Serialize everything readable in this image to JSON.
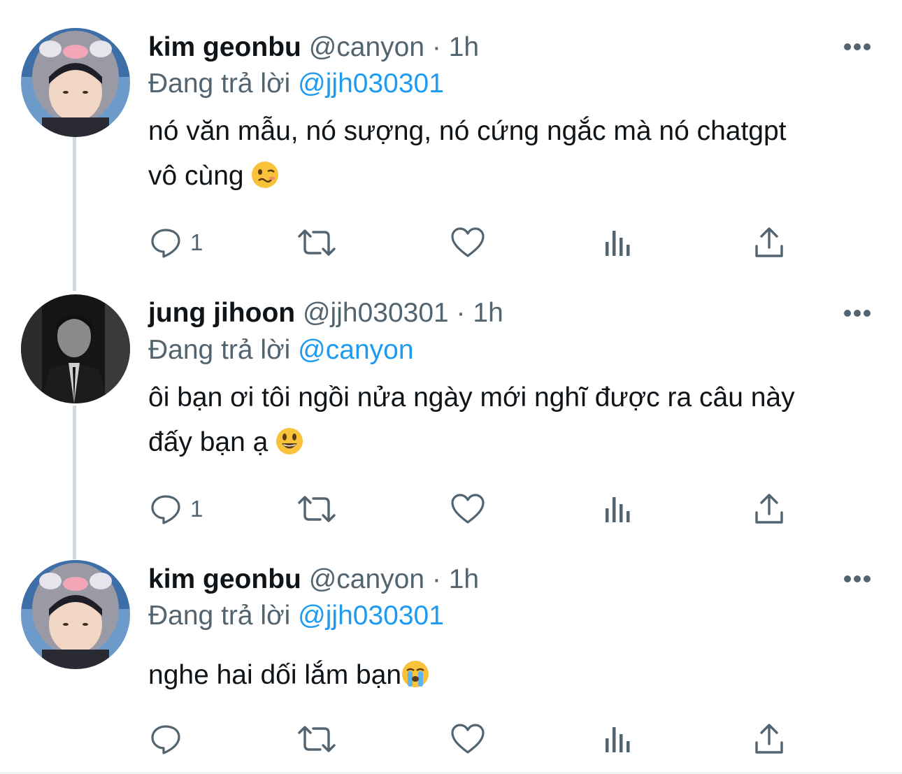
{
  "tweets": [
    {
      "name": "kim geonbu",
      "handle": "@canyon",
      "dot": "·",
      "time": "1h",
      "reply_prefix": "Đang trả lời",
      "reply_to": "@jjh030301",
      "text_line1": "nó văn mẫu, nó sượng, nó cứng ngắc mà nó chatgpt",
      "text_line2": "vô cùng",
      "emoji": "woozy-face-emoji",
      "reply_count": "1"
    },
    {
      "name": "jung jihoon",
      "handle": "@jjh030301",
      "dot": "·",
      "time": "1h",
      "reply_prefix": "Đang trả lời",
      "reply_to": "@canyon",
      "text_line1": "ôi bạn ơi tôi ngồi nửa ngày mới nghĩ được ra câu này",
      "text_line2": "đấy bạn ạ",
      "emoji": "smiley-face-emoji",
      "reply_count": "1"
    },
    {
      "name": "kim geonbu",
      "handle": "@canyon",
      "dot": "·",
      "time": "1h",
      "reply_prefix": "Đang trả lời",
      "reply_to": "@jjh030301",
      "text_line1": "nghe hai dối lắm bạn",
      "emoji": "loudly-crying-face-emoji",
      "reply_count": ""
    }
  ],
  "colors": {
    "text": "#0f1419",
    "secondary": "#536471",
    "link": "#1d9bf0",
    "thread_line": "#cfd9de"
  },
  "icons": [
    "reply-icon",
    "retweet-icon",
    "like-icon",
    "views-icon",
    "share-icon",
    "more-icon"
  ]
}
